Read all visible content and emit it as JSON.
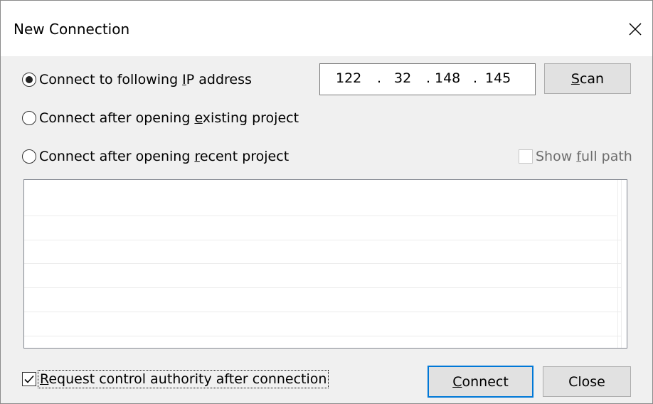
{
  "window": {
    "title": "New Connection",
    "close_glyph": "close-icon"
  },
  "options": {
    "ip": {
      "label_pre": "Connect to following ",
      "label_key": "I",
      "label_post": "P address",
      "selected": true
    },
    "existing": {
      "label_pre": "Connect after opening ",
      "label_key": "e",
      "label_post": "xisting project",
      "selected": false
    },
    "recent": {
      "label_pre": "Connect after opening ",
      "label_key": "r",
      "label_post": "ecent project",
      "selected": false
    }
  },
  "ip_address": {
    "octet1": "122",
    "octet2": "32",
    "octet3": "148",
    "octet4": "145",
    "separator": "."
  },
  "scan_button": {
    "label_key": "S",
    "label_post": "can"
  },
  "show_full_path": {
    "label_pre": "Show ",
    "label_key": "f",
    "label_post": "ull path",
    "checked": false,
    "enabled": false
  },
  "request_control": {
    "label_key": "R",
    "label_post": "equest control authority after connection",
    "checked": true
  },
  "connect_button": {
    "label_key": "C",
    "label_post": "onnect"
  },
  "close_button": {
    "label": "Close"
  },
  "colors": {
    "dialog_bg": "#f0f0f0",
    "title_bg": "#ffffff",
    "default_button_border": "#0078d7",
    "disabled_text": "#6d6d6d"
  }
}
